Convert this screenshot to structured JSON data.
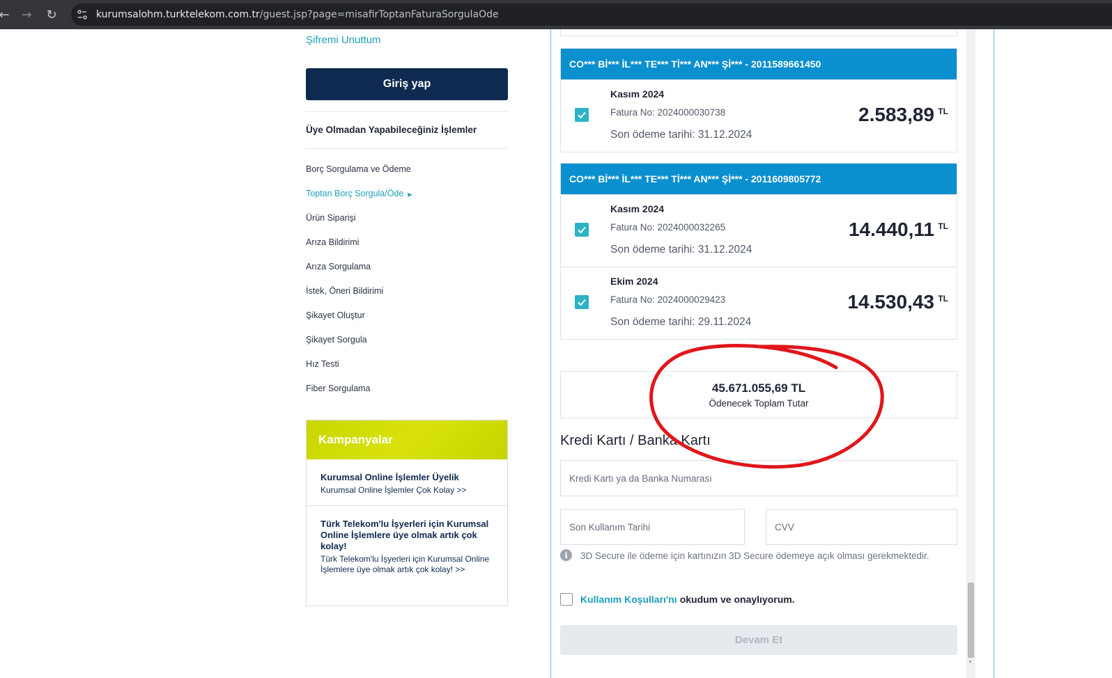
{
  "browser": {
    "url_host": "kurumsalohm.turktelekom.com.tr",
    "url_path": "/guest.jsp?page=misafirToptanFaturaSorgulaOde"
  },
  "sidebar": {
    "forgot_password": "Şifremi Unuttum",
    "login_button": "Giriş yap",
    "section_title": "Üye Olmadan Yapabileceğiniz İşlemler",
    "menu": [
      {
        "label": "Borç Sorgulama ve Ödeme"
      },
      {
        "label": "Toptan Borç Sorgula/Öde",
        "active": true
      },
      {
        "label": "Ürün Siparişi"
      },
      {
        "label": "Arıza Bildirimi"
      },
      {
        "label": "Arıza Sorgulama"
      },
      {
        "label": "İstek, Öneri Bildirimi"
      },
      {
        "label": "Şikayet Oluştur"
      },
      {
        "label": "Şikayet Sorgula"
      },
      {
        "label": "Hız Testi"
      },
      {
        "label": "Fiber Sorgulama"
      }
    ],
    "campaigns": {
      "title": "Kampanyalar",
      "items": [
        {
          "title": "Kurumsal Online İşlemler Üyelik",
          "desc": "Kurumsal Online İşlemler Çok Kolay >>"
        },
        {
          "title": "Türk Telekom'lu İşyerleri için Kurumsal Online İşlemlere üye olmak artık çok kolay!",
          "desc": "Türk Telekom'lu İşyerleri için Kurumsal Online İşlemlere üye olmak artık çok kolay! >>"
        }
      ]
    }
  },
  "accounts": [
    {
      "header": "CO*** Bİ*** İL*** TE*** Tİ*** AN*** Şİ*** - 2011589661450",
      "invoices": [
        {
          "month": "Kasım 2024",
          "invoice_no": "Fatura No: 2024000030738",
          "due": "Son ödeme tarihi: 31.12.2024",
          "amount": "2.583,89",
          "currency": "TL",
          "checked": true
        }
      ]
    },
    {
      "header": "CO*** Bİ*** İL*** TE*** Tİ*** AN*** Şİ*** - 2011609805772",
      "invoices": [
        {
          "month": "Kasım 2024",
          "invoice_no": "Fatura No: 2024000032265",
          "due": "Son ödeme tarihi: 31.12.2024",
          "amount": "14.440,11",
          "currency": "TL",
          "checked": true
        },
        {
          "month": "Ekim 2024",
          "invoice_no": "Fatura No: 2024000029423",
          "due": "Son ödeme tarihi: 29.11.2024",
          "amount": "14.530,43",
          "currency": "TL",
          "checked": true
        }
      ]
    }
  ],
  "total": {
    "amount": "45.671.055,69 TL",
    "label": "Ödenecek Toplam Tutar"
  },
  "payment": {
    "title": "Kredi Kartı / Banka Kartı",
    "card_number_placeholder": "Kredi Kartı ya da Banka Numarası",
    "expiry_placeholder": "Son Kullanım Tarihi",
    "cvv_placeholder": "CVV",
    "secure_info": "3D Secure ile ödeme için kartınızın 3D Secure ödemeye açık olması gerekmektedir.",
    "terms_link": "Kullanım Koşulları'nı",
    "terms_rest": "okudum ve onaylıyorum.",
    "continue_button": "Devam Et"
  },
  "colors": {
    "brand_navy": "#0f2a50",
    "brand_blue": "#0a8fcf",
    "teal": "#1ea0b9",
    "campaign_green": "#c9d600",
    "annotation_red": "#e0161b"
  }
}
